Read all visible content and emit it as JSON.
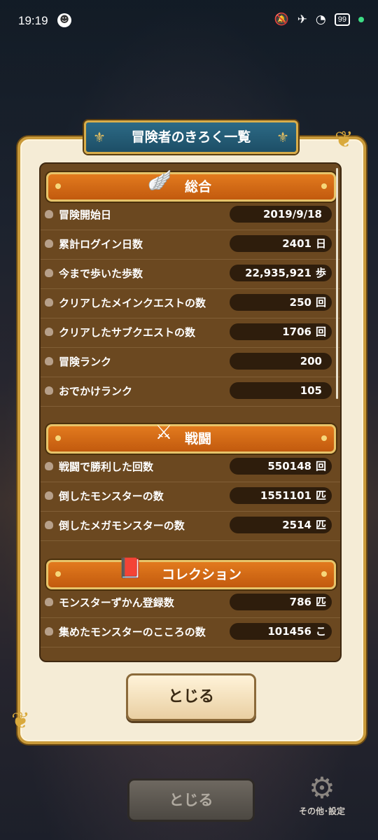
{
  "status_bar": {
    "time": "19:19",
    "app_glyph": "☻",
    "battery": "99"
  },
  "dialog": {
    "title": "冒険者のきろく一覧",
    "close_label": "とじる",
    "sections": [
      {
        "title": "総合",
        "icon": "wing-icon",
        "rows": [
          {
            "label": "冒険開始日",
            "value": "2019/9/18",
            "unit": ""
          },
          {
            "label": "累計ログイン日数",
            "value": "2401",
            "unit": "日"
          },
          {
            "label": "今まで歩いた歩数",
            "value": "22,935,921",
            "unit": "歩"
          },
          {
            "label": "クリアしたメインクエストの数",
            "value": "250",
            "unit": "回"
          },
          {
            "label": "クリアしたサブクエストの数",
            "value": "1706",
            "unit": "回"
          },
          {
            "label": "冒険ランク",
            "value": "200",
            "unit": ""
          },
          {
            "label": "おでかけランク",
            "value": "105",
            "unit": ""
          }
        ]
      },
      {
        "title": "戦闘",
        "icon": "crossed-swords-icon",
        "rows": [
          {
            "label": "戦闘で勝利した回数",
            "value": "550148",
            "unit": "回"
          },
          {
            "label": "倒したモンスターの数",
            "value": "1551101",
            "unit": "匹"
          },
          {
            "label": "倒したメガモンスターの数",
            "value": "2514",
            "unit": "匹"
          }
        ]
      },
      {
        "title": "コレクション",
        "icon": "book-icon",
        "rows": [
          {
            "label": "モンスターずかん登録数",
            "value": "786",
            "unit": "匹"
          },
          {
            "label": "集めたモンスターのこころの数",
            "value": "101456",
            "unit": "こ"
          }
        ]
      }
    ]
  },
  "background": {
    "close_label": "とじる",
    "settings_label": "その他･設定"
  },
  "colors": {
    "panel": "#f5ecd6",
    "section_header": "#d2681a",
    "list_bg": "#6b4820",
    "title_plate": "#24607a"
  }
}
